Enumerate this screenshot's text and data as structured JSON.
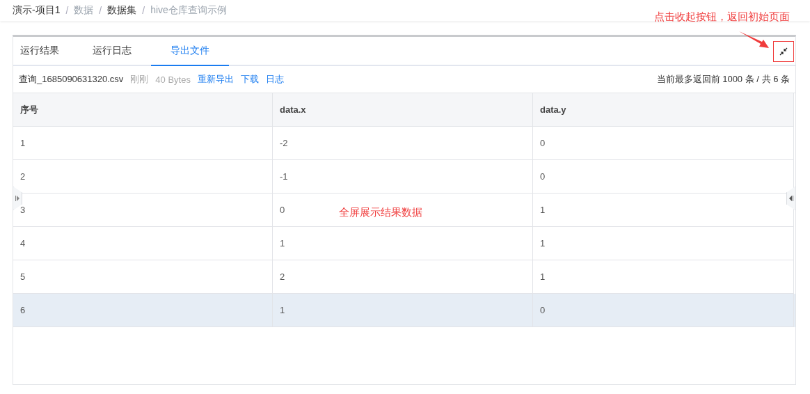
{
  "breadcrumb": [
    {
      "label": "演示-项目1",
      "kind": "current"
    },
    {
      "label": "数据",
      "kind": "muted"
    },
    {
      "label": "数据集",
      "kind": "current"
    },
    {
      "label": "hive仓库查询示例",
      "kind": "muted"
    }
  ],
  "breadcrumb_separator": "/",
  "tabs": [
    {
      "label": "运行结果",
      "selected": false
    },
    {
      "label": "运行日志",
      "selected": false
    },
    {
      "label": "导出文件",
      "selected": true
    }
  ],
  "file_bar": {
    "file_name": "查询_1685090631320.csv",
    "time": "刚刚",
    "size": "40 Bytes",
    "actions": [
      "重新导出",
      "下载",
      "日志"
    ],
    "summary": "当前最多返回前 1000 条 / 共 6 条"
  },
  "table": {
    "columns": [
      "序号",
      "data.x",
      "data.y"
    ],
    "rows": [
      {
        "cells": [
          "1",
          "-2",
          "0"
        ],
        "highlighted": false
      },
      {
        "cells": [
          "2",
          "-1",
          "0"
        ],
        "highlighted": false
      },
      {
        "cells": [
          "3",
          "0",
          "1"
        ],
        "highlighted": false
      },
      {
        "cells": [
          "4",
          "1",
          "1"
        ],
        "highlighted": false
      },
      {
        "cells": [
          "5",
          "2",
          "1"
        ],
        "highlighted": false
      },
      {
        "cells": [
          "6",
          "1",
          "0"
        ],
        "highlighted": true
      }
    ]
  },
  "annotations": {
    "collapse_hint": "点击收起按钮，返回初始页面",
    "table_hint": "全屏展示结果数据"
  }
}
